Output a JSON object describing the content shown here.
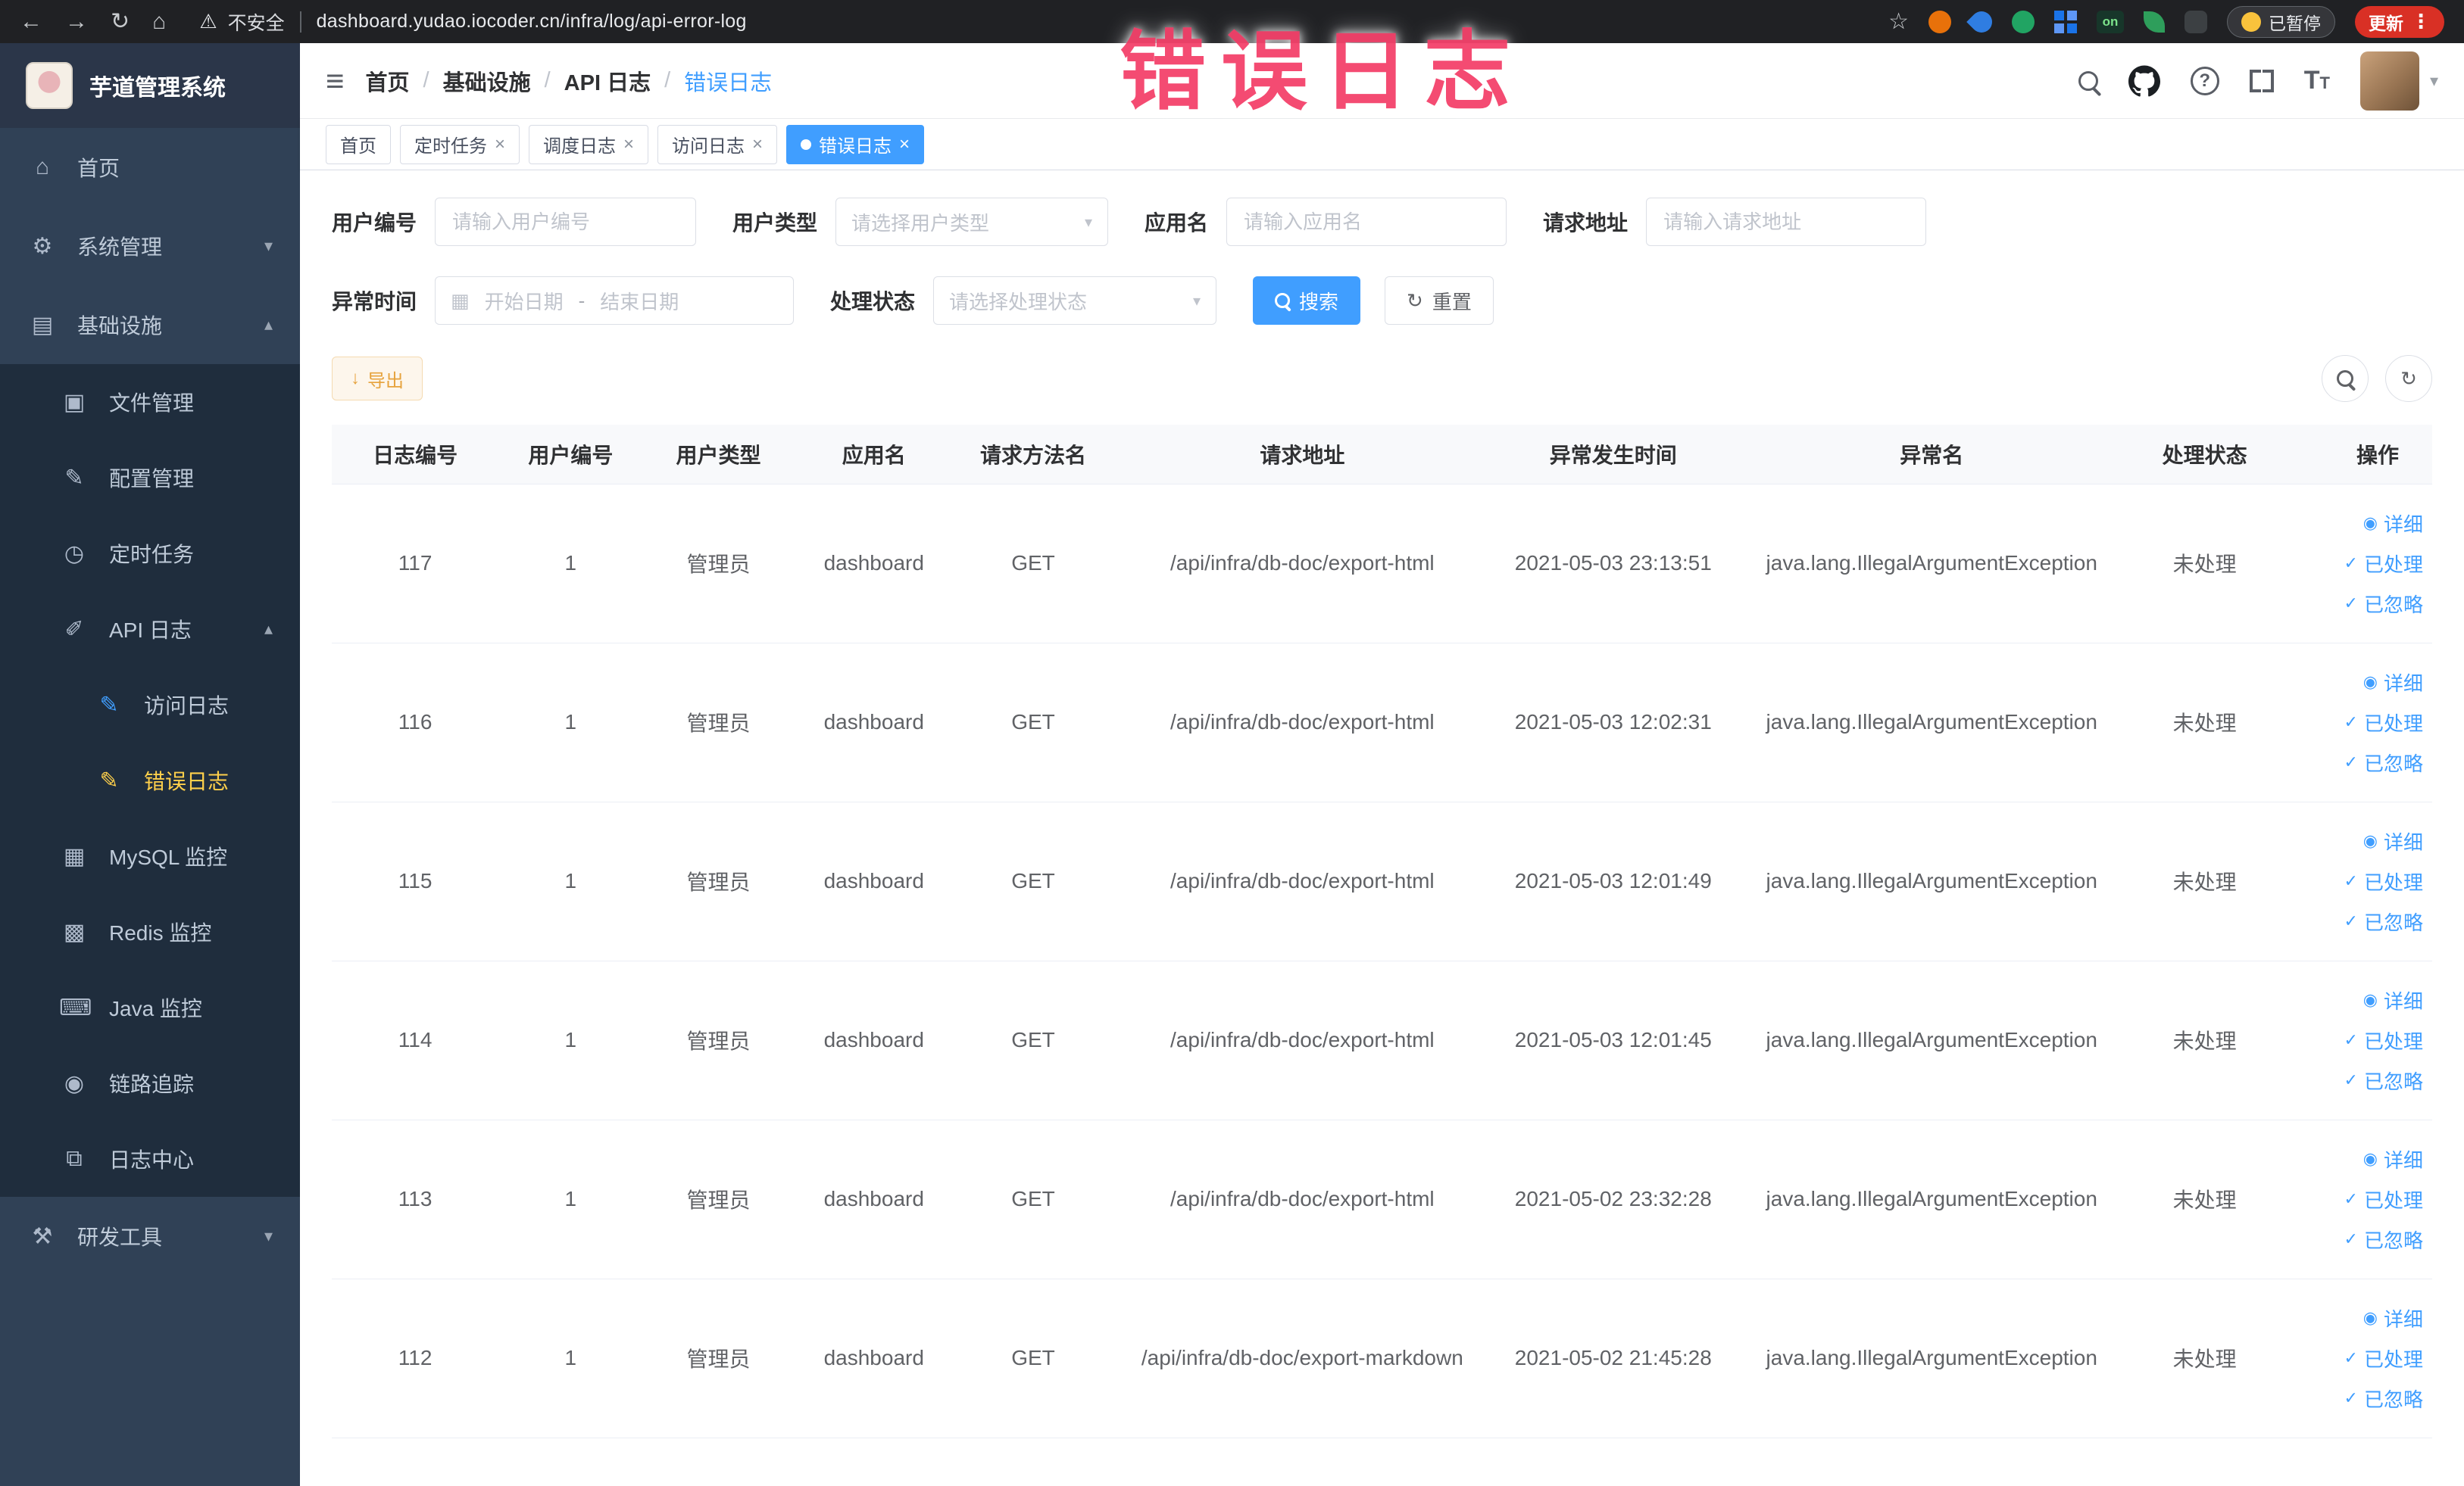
{
  "browser": {
    "security_label": "不安全",
    "url": "dashboard.yudao.iocoder.cn/infra/log/api-error-log",
    "ext_on_label": "on",
    "paused_label": "已暂停",
    "update_label": "更新"
  },
  "icons": {
    "back": "←",
    "forward": "→",
    "reload": "↻",
    "home_nav": "⌂",
    "warning": "⚠",
    "star": "☆",
    "kebab": "⋮",
    "hamburger": "≡",
    "home": "⌂",
    "gear": "⚙",
    "infra": "▤",
    "file": "▣",
    "config": "✎",
    "timer": "◷",
    "apilog": "✐",
    "accesslog": "✎",
    "errorlog": "✎",
    "mysql": "▦",
    "redis": "▩",
    "java": "⌨",
    "trace": "◉",
    "logcenter": "⧉",
    "devtools": "⚒",
    "chev_down": "▾",
    "chev_up": "▴",
    "caret_down": "▾",
    "calendar": "▦",
    "refresh": "↻",
    "download": "↓",
    "eye": "◉",
    "check": "✓",
    "close": "×"
  },
  "annotation": {
    "text": "错误日志"
  },
  "sidebar": {
    "title": "芋道管理系统",
    "menu": [
      {
        "label": "首页"
      },
      {
        "label": "系统管理"
      },
      {
        "label": "基础设施"
      },
      {
        "label": "文件管理"
      },
      {
        "label": "配置管理"
      },
      {
        "label": "定时任务"
      },
      {
        "label": "API 日志"
      },
      {
        "label": "访问日志"
      },
      {
        "label": "错误日志"
      },
      {
        "label": "MySQL 监控"
      },
      {
        "label": "Redis 监控"
      },
      {
        "label": "Java 监控"
      },
      {
        "label": "链路追踪"
      },
      {
        "label": "日志中心"
      },
      {
        "label": "研发工具"
      }
    ]
  },
  "navbar": {
    "separator": "/",
    "breadcrumb": [
      {
        "label": "首页"
      },
      {
        "label": "基础设施"
      },
      {
        "label": "API 日志"
      },
      {
        "label": "错误日志"
      }
    ]
  },
  "tags": [
    {
      "label": "首页"
    },
    {
      "label": "定时任务"
    },
    {
      "label": "调度日志"
    },
    {
      "label": "访问日志"
    },
    {
      "label": "错误日志"
    }
  ],
  "filters": {
    "user_id_label": "用户编号",
    "user_id_placeholder": "请输入用户编号",
    "user_type_label": "用户类型",
    "user_type_placeholder": "请选择用户类型",
    "app_name_label": "应用名",
    "app_name_placeholder": "请输入应用名",
    "request_url_label": "请求地址",
    "request_url_placeholder": "请输入请求地址",
    "time_label": "异常时间",
    "time_start_placeholder": "开始日期",
    "time_separator": "-",
    "time_end_placeholder": "结束日期",
    "status_label": "处理状态",
    "status_placeholder": "请选择处理状态",
    "search_label": "搜索",
    "reset_label": "重置"
  },
  "toolbar": {
    "export_label": "导出"
  },
  "table": {
    "columns": [
      "日志编号",
      "用户编号",
      "用户类型",
      "应用名",
      "请求方法名",
      "请求地址",
      "异常发生时间",
      "异常名",
      "处理状态",
      "操作"
    ],
    "actions": {
      "detail": "详细",
      "processed": "已处理",
      "ignored": "已忽略"
    },
    "rows": [
      {
        "id": "117",
        "user_id": "1",
        "user_type": "管理员",
        "app_name": "dashboard",
        "method": "GET",
        "url": "/api/infra/db-doc/export-html",
        "time": "2021-05-03 23:13:51",
        "exception": "java.lang.IllegalArgumentException",
        "status": "未处理"
      },
      {
        "id": "116",
        "user_id": "1",
        "user_type": "管理员",
        "app_name": "dashboard",
        "method": "GET",
        "url": "/api/infra/db-doc/export-html",
        "time": "2021-05-03 12:02:31",
        "exception": "java.lang.IllegalArgumentException",
        "status": "未处理"
      },
      {
        "id": "115",
        "user_id": "1",
        "user_type": "管理员",
        "app_name": "dashboard",
        "method": "GET",
        "url": "/api/infra/db-doc/export-html",
        "time": "2021-05-03 12:01:49",
        "exception": "java.lang.IllegalArgumentException",
        "status": "未处理"
      },
      {
        "id": "114",
        "user_id": "1",
        "user_type": "管理员",
        "app_name": "dashboard",
        "method": "GET",
        "url": "/api/infra/db-doc/export-html",
        "time": "2021-05-03 12:01:45",
        "exception": "java.lang.IllegalArgumentException",
        "status": "未处理"
      },
      {
        "id": "113",
        "user_id": "1",
        "user_type": "管理员",
        "app_name": "dashboard",
        "method": "GET",
        "url": "/api/infra/db-doc/export-html",
        "time": "2021-05-02 23:32:28",
        "exception": "java.lang.IllegalArgumentException",
        "status": "未处理"
      },
      {
        "id": "112",
        "user_id": "1",
        "user_type": "管理员",
        "app_name": "dashboard",
        "method": "GET",
        "url": "/api/infra/db-doc/export-markdown",
        "time": "2021-05-02 21:45:28",
        "exception": "java.lang.IllegalArgumentException",
        "status": "未处理"
      }
    ]
  },
  "colors": {
    "accent": "#409eff",
    "menu_active": "#ffd04b",
    "warning": "#e6a23c",
    "annotation": "#f4426b",
    "update_badge": "#d93025"
  }
}
